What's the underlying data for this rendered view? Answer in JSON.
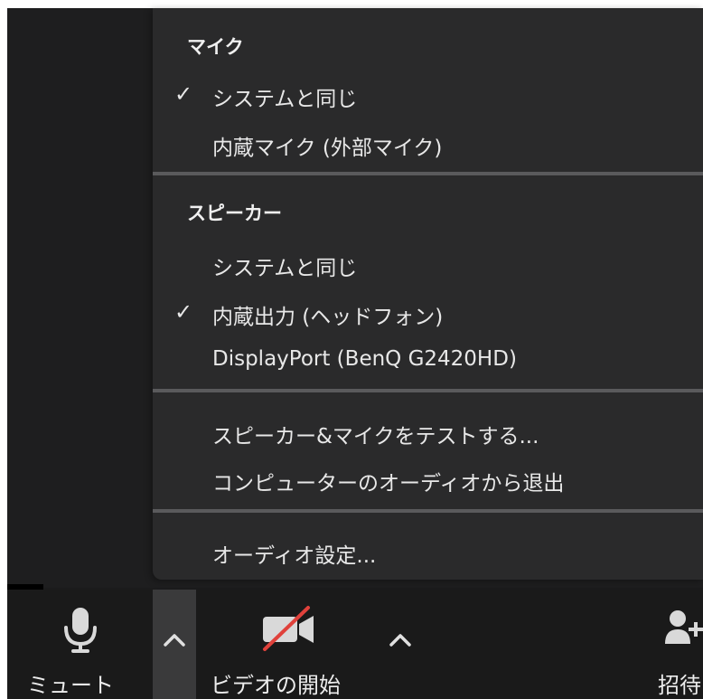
{
  "menu": {
    "mic_header": "マイク",
    "mic_items": [
      {
        "label": "システムと同じ",
        "checked": true
      },
      {
        "label": "内蔵マイク (外部マイク)",
        "checked": false
      }
    ],
    "speaker_header": "スピーカー",
    "speaker_items": [
      {
        "label": "システムと同じ",
        "checked": false
      },
      {
        "label": "内蔵出力 (ヘッドフォン)",
        "checked": true
      },
      {
        "label": "DisplayPort (BenQ G2420HD)",
        "checked": false
      }
    ],
    "actions": [
      {
        "label": "スピーカー&マイクをテストする..."
      },
      {
        "label": "コンピューターのオーディオから退出"
      }
    ],
    "settings_label": "オーディオ設定...",
    "check_glyph": "✓"
  },
  "toolbar": {
    "mute_label": "ミュート",
    "video_label": "ビデオの開始",
    "invite_label": "招待"
  }
}
